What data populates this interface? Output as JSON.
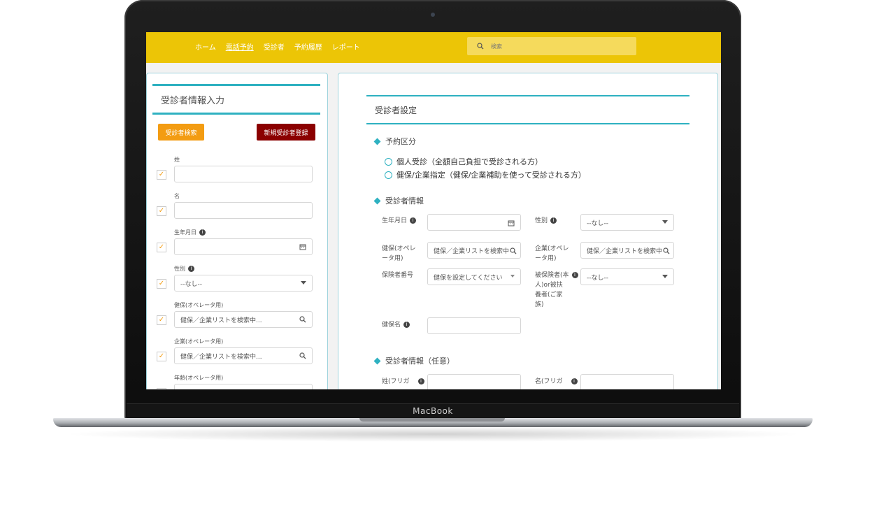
{
  "device": {
    "brand": "MacBook"
  },
  "nav": {
    "items": [
      "ホーム",
      "電話予約",
      "受診者",
      "予約履歴",
      "レポート"
    ],
    "active_index": 1
  },
  "search": {
    "placeholder": "検索"
  },
  "left": {
    "title": "受診者情報入力",
    "search_button": "受診者検索",
    "register_button": "新規受診者登録",
    "fields": {
      "last_name": "姓",
      "first_name": "名",
      "birthdate": "生年月日",
      "gender": "性別",
      "gender_value": "--なし--",
      "insurance": "健保(オペレータ用)",
      "insurance_placeholder": "健保／企業リストを検索中...",
      "company": "企業(オペレータ用)",
      "company_placeholder": "健保／企業リストを検索中...",
      "age": "年齢(オペレータ用)"
    }
  },
  "right": {
    "title": "受診者設定",
    "sec1": "予約区分",
    "radio1": "個人受診（全額自己負担で受診される方）",
    "radio2": "健保/企業指定（健保/企業補助を使って受診される方）",
    "sec2": "受診者情報",
    "birthdate": "生年月日",
    "gender": "性別",
    "gender_value": "--なし--",
    "insurance_l1": "健保(オペレ",
    "insurance_l2": "ータ用)",
    "insurance_ph": "健保／企業リストを検索中",
    "company_l1": "企業(オペレ",
    "company_l2": "ータ用)",
    "company_ph": "健保／企業リストを検索中",
    "ins_no": "保険者番号",
    "ins_no_value": "健保を設定してください",
    "insured_l1": "被保険者(本",
    "insured_l2": "人)or被扶",
    "insured_l3": "養者(ご家",
    "insured_l4": "族)",
    "insured_value": "--なし--",
    "ins_name": "健保名",
    "sec3": "受診者情報（任意）",
    "kana_last": "姓(フリガ",
    "kana_first": "名(フリガ"
  }
}
